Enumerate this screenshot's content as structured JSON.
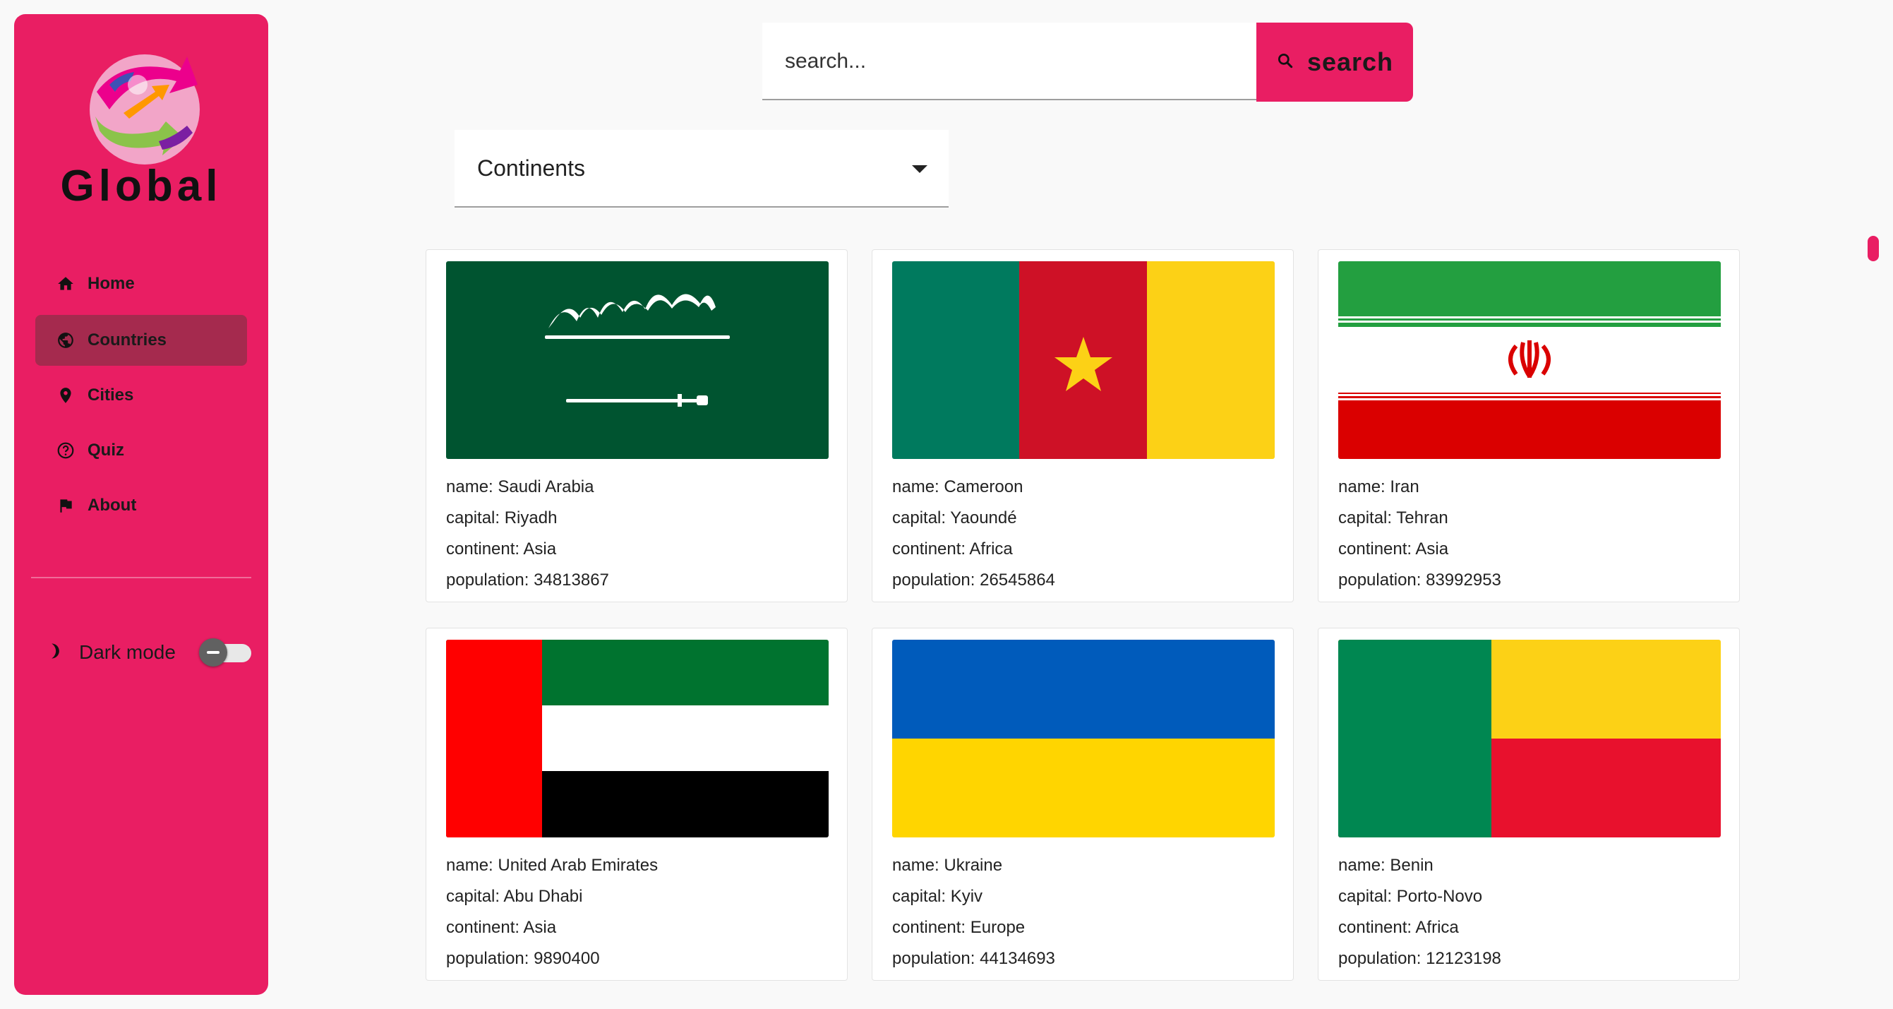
{
  "sidebar": {
    "brand": "Global",
    "nav": [
      {
        "label": "Home",
        "icon": "home-icon"
      },
      {
        "label": "Countries",
        "icon": "globe-icon",
        "active": true
      },
      {
        "label": "Cities",
        "icon": "map-pin-icon"
      },
      {
        "label": "Quiz",
        "icon": "question-circle-icon"
      },
      {
        "label": "About",
        "icon": "flag-icon"
      }
    ],
    "dark_mode": {
      "label": "Dark mode",
      "enabled": false
    }
  },
  "search": {
    "placeholder": "search...",
    "button_label": "search"
  },
  "filter": {
    "selected": "Continents"
  },
  "countries": [
    {
      "name": "name: Saudi Arabia",
      "capital": "capital: Riyadh",
      "continent": "continent: Asia",
      "population": "population: 34813867"
    },
    {
      "name": "name: Cameroon",
      "capital": "capital: Yaoundé",
      "continent": "continent: Africa",
      "population": "population: 26545864"
    },
    {
      "name": "name: Iran",
      "capital": "capital: Tehran",
      "continent": "continent: Asia",
      "population": "population: 83992953"
    },
    {
      "name": "name: United Arab Emirates",
      "capital": "capital: Abu Dhabi",
      "continent": "continent: Asia",
      "population": "population: 9890400"
    },
    {
      "name": "name: Ukraine",
      "capital": "capital: Kyiv",
      "continent": "continent: Europe",
      "population": "population: 44134693"
    },
    {
      "name": "name: Benin",
      "capital": "capital: Porto-Novo",
      "continent": "continent: Africa",
      "population": "population: 12123198"
    }
  ],
  "colors": {
    "accent": "#e91e63",
    "active_nav": "#a52a4e",
    "background": "#f9f9f9"
  }
}
